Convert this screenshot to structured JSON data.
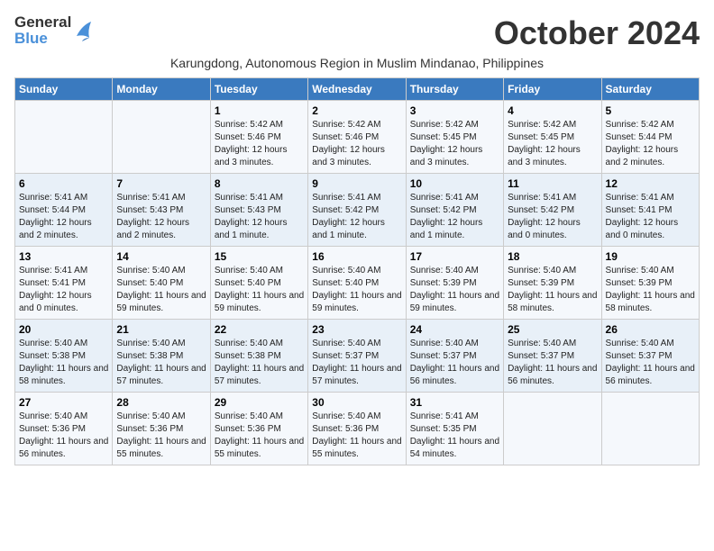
{
  "logo": {
    "line1": "General",
    "line2": "Blue",
    "bird_symbol": "▶"
  },
  "title": "October 2024",
  "subtitle": "Karungdong, Autonomous Region in Muslim Mindanao, Philippines",
  "weekdays": [
    "Sunday",
    "Monday",
    "Tuesday",
    "Wednesday",
    "Thursday",
    "Friday",
    "Saturday"
  ],
  "weeks": [
    [
      {
        "day": "",
        "info": ""
      },
      {
        "day": "",
        "info": ""
      },
      {
        "day": "1",
        "info": "Sunrise: 5:42 AM\nSunset: 5:46 PM\nDaylight: 12 hours and 3 minutes."
      },
      {
        "day": "2",
        "info": "Sunrise: 5:42 AM\nSunset: 5:46 PM\nDaylight: 12 hours and 3 minutes."
      },
      {
        "day": "3",
        "info": "Sunrise: 5:42 AM\nSunset: 5:45 PM\nDaylight: 12 hours and 3 minutes."
      },
      {
        "day": "4",
        "info": "Sunrise: 5:42 AM\nSunset: 5:45 PM\nDaylight: 12 hours and 3 minutes."
      },
      {
        "day": "5",
        "info": "Sunrise: 5:42 AM\nSunset: 5:44 PM\nDaylight: 12 hours and 2 minutes."
      }
    ],
    [
      {
        "day": "6",
        "info": "Sunrise: 5:41 AM\nSunset: 5:44 PM\nDaylight: 12 hours and 2 minutes."
      },
      {
        "day": "7",
        "info": "Sunrise: 5:41 AM\nSunset: 5:43 PM\nDaylight: 12 hours and 2 minutes."
      },
      {
        "day": "8",
        "info": "Sunrise: 5:41 AM\nSunset: 5:43 PM\nDaylight: 12 hours and 1 minute."
      },
      {
        "day": "9",
        "info": "Sunrise: 5:41 AM\nSunset: 5:42 PM\nDaylight: 12 hours and 1 minute."
      },
      {
        "day": "10",
        "info": "Sunrise: 5:41 AM\nSunset: 5:42 PM\nDaylight: 12 hours and 1 minute."
      },
      {
        "day": "11",
        "info": "Sunrise: 5:41 AM\nSunset: 5:42 PM\nDaylight: 12 hours and 0 minutes."
      },
      {
        "day": "12",
        "info": "Sunrise: 5:41 AM\nSunset: 5:41 PM\nDaylight: 12 hours and 0 minutes."
      }
    ],
    [
      {
        "day": "13",
        "info": "Sunrise: 5:41 AM\nSunset: 5:41 PM\nDaylight: 12 hours and 0 minutes."
      },
      {
        "day": "14",
        "info": "Sunrise: 5:40 AM\nSunset: 5:40 PM\nDaylight: 11 hours and 59 minutes."
      },
      {
        "day": "15",
        "info": "Sunrise: 5:40 AM\nSunset: 5:40 PM\nDaylight: 11 hours and 59 minutes."
      },
      {
        "day": "16",
        "info": "Sunrise: 5:40 AM\nSunset: 5:40 PM\nDaylight: 11 hours and 59 minutes."
      },
      {
        "day": "17",
        "info": "Sunrise: 5:40 AM\nSunset: 5:39 PM\nDaylight: 11 hours and 59 minutes."
      },
      {
        "day": "18",
        "info": "Sunrise: 5:40 AM\nSunset: 5:39 PM\nDaylight: 11 hours and 58 minutes."
      },
      {
        "day": "19",
        "info": "Sunrise: 5:40 AM\nSunset: 5:39 PM\nDaylight: 11 hours and 58 minutes."
      }
    ],
    [
      {
        "day": "20",
        "info": "Sunrise: 5:40 AM\nSunset: 5:38 PM\nDaylight: 11 hours and 58 minutes."
      },
      {
        "day": "21",
        "info": "Sunrise: 5:40 AM\nSunset: 5:38 PM\nDaylight: 11 hours and 57 minutes."
      },
      {
        "day": "22",
        "info": "Sunrise: 5:40 AM\nSunset: 5:38 PM\nDaylight: 11 hours and 57 minutes."
      },
      {
        "day": "23",
        "info": "Sunrise: 5:40 AM\nSunset: 5:37 PM\nDaylight: 11 hours and 57 minutes."
      },
      {
        "day": "24",
        "info": "Sunrise: 5:40 AM\nSunset: 5:37 PM\nDaylight: 11 hours and 56 minutes."
      },
      {
        "day": "25",
        "info": "Sunrise: 5:40 AM\nSunset: 5:37 PM\nDaylight: 11 hours and 56 minutes."
      },
      {
        "day": "26",
        "info": "Sunrise: 5:40 AM\nSunset: 5:37 PM\nDaylight: 11 hours and 56 minutes."
      }
    ],
    [
      {
        "day": "27",
        "info": "Sunrise: 5:40 AM\nSunset: 5:36 PM\nDaylight: 11 hours and 56 minutes."
      },
      {
        "day": "28",
        "info": "Sunrise: 5:40 AM\nSunset: 5:36 PM\nDaylight: 11 hours and 55 minutes."
      },
      {
        "day": "29",
        "info": "Sunrise: 5:40 AM\nSunset: 5:36 PM\nDaylight: 11 hours and 55 minutes."
      },
      {
        "day": "30",
        "info": "Sunrise: 5:40 AM\nSunset: 5:36 PM\nDaylight: 11 hours and 55 minutes."
      },
      {
        "day": "31",
        "info": "Sunrise: 5:41 AM\nSunset: 5:35 PM\nDaylight: 11 hours and 54 minutes."
      },
      {
        "day": "",
        "info": ""
      },
      {
        "day": "",
        "info": ""
      }
    ]
  ]
}
